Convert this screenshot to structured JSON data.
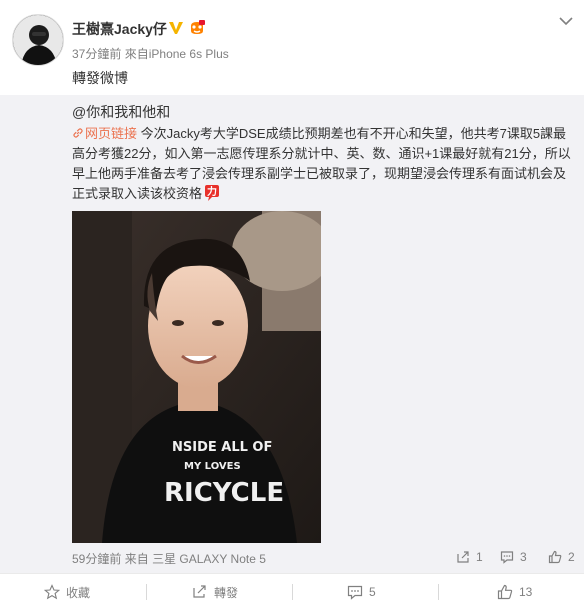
{
  "post": {
    "username": "王樹熹Jacky仔",
    "time": "37分鐘前",
    "source_prefix": "來自",
    "source": "iPhone 6s Plus",
    "text": "轉發微博",
    "verified_icon": "verified-v-icon",
    "member_icon": "vip-member-icon"
  },
  "repost": {
    "author": "@你和我和他和",
    "link_label": "网页链接",
    "body": "今次Jacky考大学DSE成绩比预期差也有不开心和失望，他共考7课取5課最高分考獲22分，如入第一志愿传理系分就计中、英、数、通识+1课最好就有21分，所以早上他两手准备去考了浸会传理系副学士已被取录了，现期望浸会传理系有面试机会及正式录取入读该校资格",
    "emoji_icon": "strength-icon",
    "time": "59分鐘前",
    "source_prefix": "来自",
    "source": "三星 GALAXY Note 5",
    "mini_actions": [
      {
        "icon": "share-icon",
        "count": "1"
      },
      {
        "icon": "comment-icon",
        "count": "3"
      },
      {
        "icon": "like-icon",
        "count": "2"
      }
    ]
  },
  "actions": {
    "favorite": {
      "icon": "star-icon",
      "label": "收藏"
    },
    "repost": {
      "icon": "repost-icon",
      "label": "轉發"
    },
    "comment": {
      "icon": "comment-icon",
      "label": "5"
    },
    "like": {
      "icon": "thumb-up-icon",
      "label": "13"
    }
  },
  "colors": {
    "link": "#eb7350",
    "repost_bg": "#f2f2f5",
    "meta_text": "#808080",
    "verified": "#f5b400"
  }
}
